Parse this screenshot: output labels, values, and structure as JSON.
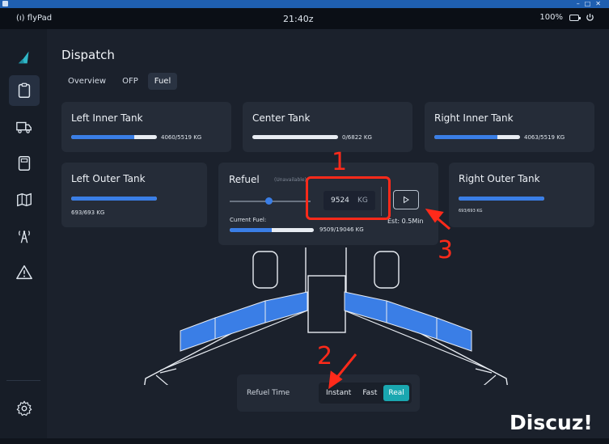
{
  "statusbar": {
    "app_name": "flyPad",
    "time": "21:40z",
    "battery": "100%"
  },
  "page": {
    "title": "Dispatch"
  },
  "tabs": [
    {
      "label": "Overview",
      "active": false
    },
    {
      "label": "OFP",
      "active": false
    },
    {
      "label": "Fuel",
      "active": true
    }
  ],
  "tanks": {
    "left_inner": {
      "label": "Left Inner Tank",
      "value": "4060/5519 KG",
      "fill": 0.736
    },
    "center": {
      "label": "Center Tank",
      "value": "0/6822 KG",
      "fill": 0.0
    },
    "right_inner": {
      "label": "Right Inner Tank",
      "value": "4063/5519 KG",
      "fill": 0.736
    },
    "left_outer": {
      "label": "Left Outer Tank",
      "value": "693/693 KG",
      "fill": 1.0
    },
    "right_outer": {
      "label": "Right Outer Tank",
      "value": "693/693 KG",
      "fill": 1.0
    }
  },
  "refuel": {
    "title": "Refuel",
    "status": "(Unavailable)",
    "target_value": "9524",
    "target_unit": "KG",
    "slider_fraction": 0.5,
    "estimate": "Est: 0.5Min",
    "current_label": "Current Fuel:",
    "current_value": "9509/19046 KG",
    "current_fill": 0.499
  },
  "refuel_time": {
    "label": "Refuel Time",
    "options": [
      {
        "label": "Instant",
        "active": false
      },
      {
        "label": "Fast",
        "active": false
      },
      {
        "label": "Real",
        "active": true
      }
    ]
  },
  "annotations": {
    "n1": "1",
    "n2": "2",
    "n3": "3",
    "color": "#ff2a1a"
  },
  "watermark": "Discuz!",
  "colors": {
    "accent": "#3a7ee6",
    "active_option": "#1aa7b0",
    "sidebar_logo": "#2fb7c7"
  },
  "icons": [
    "wifi-signal-icon",
    "battery-icon",
    "power-icon",
    "logo-icon",
    "clipboard-icon",
    "truck-icon",
    "calculator-icon",
    "map-icon",
    "tower-icon",
    "warning-icon",
    "gear-icon",
    "play-icon"
  ]
}
